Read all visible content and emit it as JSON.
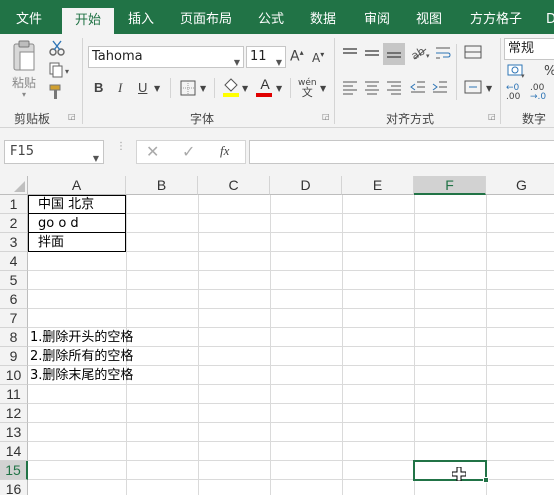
{
  "tabs": [
    "文件",
    "开始",
    "插入",
    "页面布局",
    "公式",
    "数据",
    "审阅",
    "视图",
    "方方格子",
    "D"
  ],
  "ribbon": {
    "paste_label": "粘贴",
    "clipboard_group": "剪贴板",
    "font_name": "Tahoma",
    "font_size": "11",
    "font_group": "字体",
    "bold": "B",
    "italic": "I",
    "underline": "U",
    "font_color_glyph": "A",
    "wen_glyph": "wén",
    "align_group": "对齐方式",
    "number_format": "常规",
    "number_group": "数字",
    "percent": "%"
  },
  "formula_bar": {
    "name_box": "F15",
    "fx": "fx",
    "formula": ""
  },
  "columns": [
    "A",
    "B",
    "C",
    "D",
    "E",
    "F",
    "G"
  ],
  "rows": [
    "1",
    "2",
    "3",
    "4",
    "5",
    "6",
    "7",
    "8",
    "9",
    "10",
    "11",
    "12",
    "13",
    "14",
    "15",
    "16"
  ],
  "cells": {
    "A1": "中国  北京",
    "A2": "go  o  d",
    "A3": "拌面",
    "A8": "1.删除开头的空格",
    "A9": "2.删除所有的空格",
    "A10": "3.删除末尾的空格"
  },
  "selected_cell": "F15",
  "colors": {
    "accent": "#217346",
    "ribbon_bg": "#f3f3f3",
    "font_color_bar": "#e00000",
    "highlight_bar": "#ffff00"
  }
}
